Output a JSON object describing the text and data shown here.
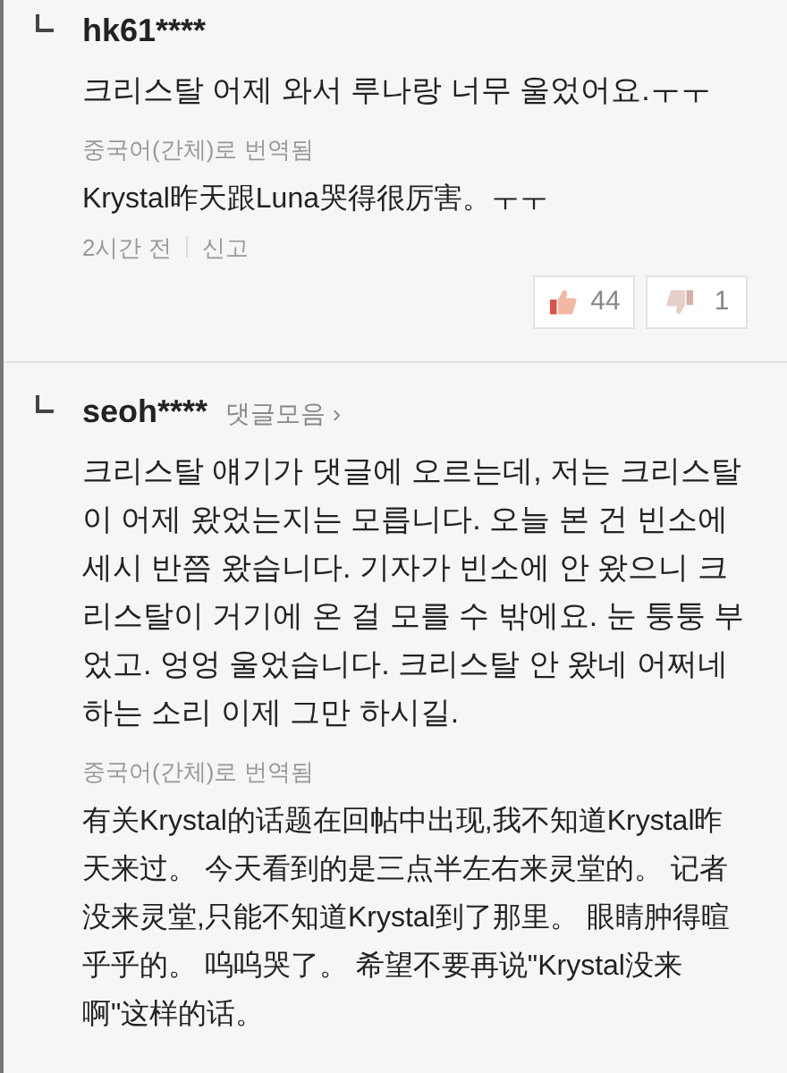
{
  "comments": [
    {
      "username": "hk61****",
      "body": "크리스탈 어제 와서 루나랑 너무 울었어요.ㅜㅜ",
      "translation_label": "중국어(간체)로 번역됨",
      "translation": "Krystal昨天跟Luna哭得很厉害。ㅜㅜ",
      "time": "2시간 전",
      "report": "신고",
      "likes": "44",
      "dislikes": "1"
    },
    {
      "username": "seoh****",
      "collection_link": "댓글모음 ›",
      "body": "크리스탈 얘기가 댓글에 오르는데, 저는 크리스탈이 어제 왔었는지는 모릅니다. 오늘 본 건 빈소에 세시 반쯤 왔습니다. 기자가 빈소에 안 왔으니 크리스탈이 거기에 온 걸 모를 수 밖에요. 눈 퉁퉁 부었고. 엉엉 울었습니다. 크리스탈 안 왔네 어쩌네 하는 소리 이제 그만 하시길.",
      "translation_label": "중국어(간체)로 번역됨",
      "translation": "有关Krystal的话题在回帖中出现,我不知道Krystal昨天来过。 今天看到的是三点半左右来灵堂的。 记者没来灵堂,只能不知道Krystal到了那里。 眼睛肿得暄乎乎的。 呜呜哭了。 希望不要再说\"Krystal没来啊\"这样的话。"
    }
  ]
}
